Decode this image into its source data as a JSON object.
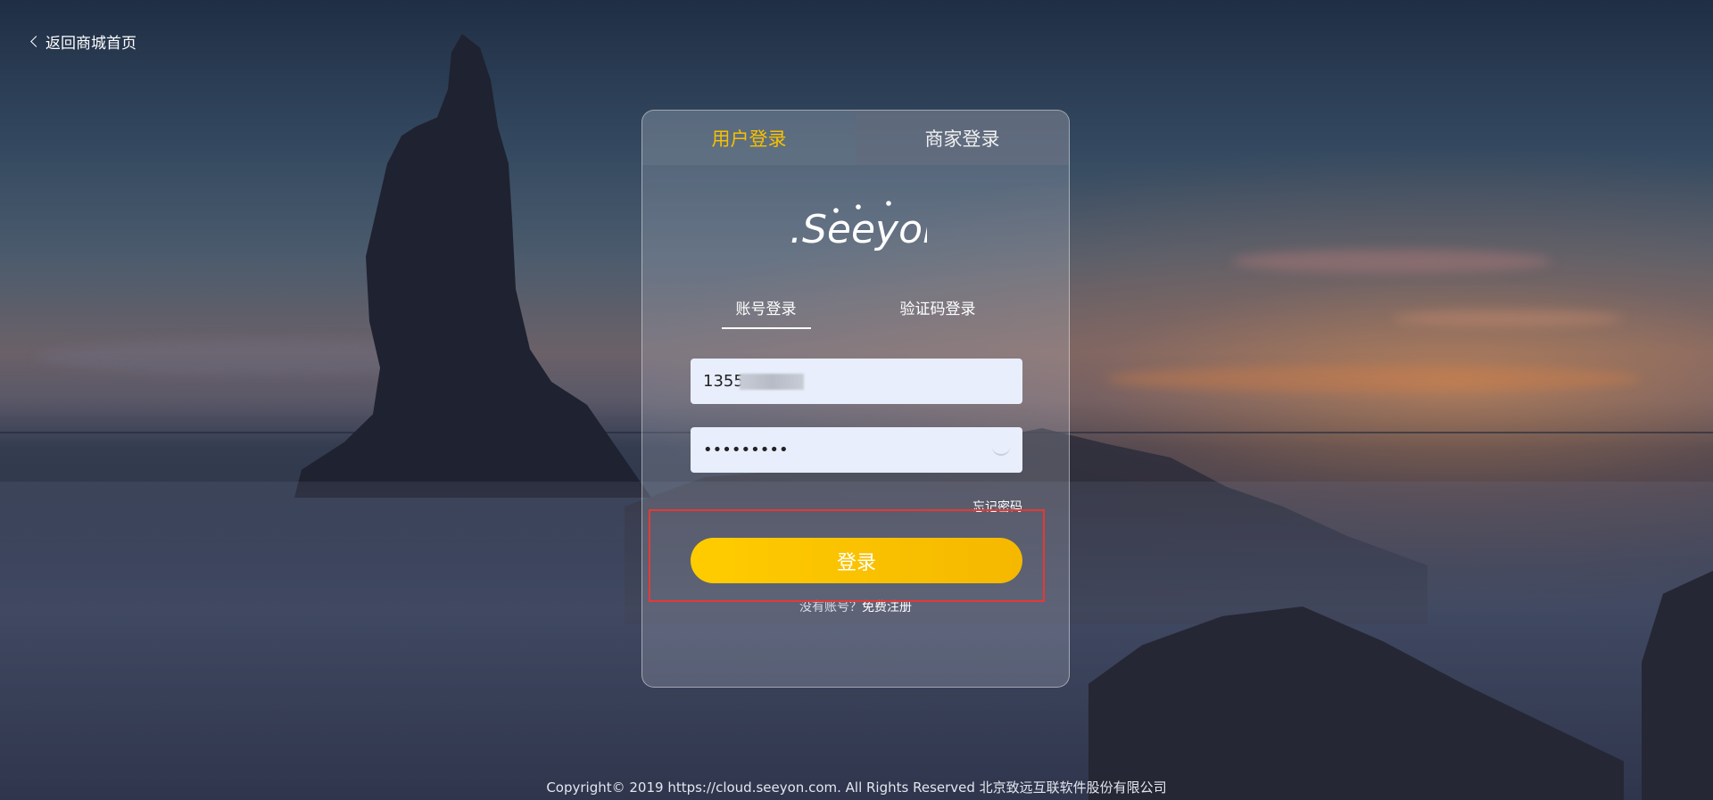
{
  "back_link": {
    "label": "返回商城首页"
  },
  "card": {
    "tabs": [
      {
        "label": "用户登录",
        "active": true
      },
      {
        "label": "商家登录",
        "active": false
      }
    ],
    "logo": {
      "text": ".Seeyon"
    },
    "sub_tabs": [
      {
        "label": "账号登录",
        "active": true
      },
      {
        "label": "验证码登录",
        "active": false
      }
    ],
    "account_field": {
      "value": "1355"
    },
    "password_field": {
      "value": "•••••••••"
    },
    "forgot_password": "忘记密码",
    "login_button": "登录",
    "register": {
      "prompt": "没有账号？",
      "link": "免费注册"
    }
  },
  "footer": {
    "text": "Copyright© 2019 https://cloud.seeyon.com. All Rights Reserved 北京致远互联软件股份有限公司"
  },
  "colors": {
    "accent": "#f7c100",
    "button_start": "#ffcc00",
    "button_end": "#f5b800",
    "highlight": "#e53935",
    "field_bg": "#e8eefb"
  }
}
